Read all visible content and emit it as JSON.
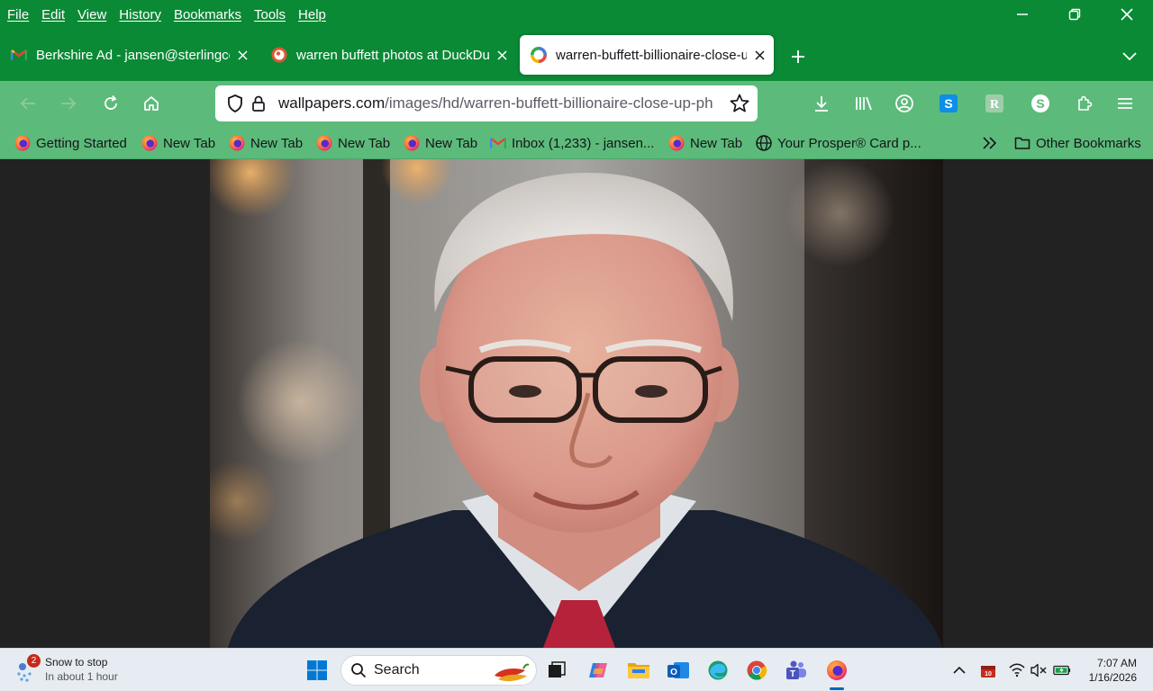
{
  "menu": {
    "items": [
      "File",
      "Edit",
      "View",
      "History",
      "Bookmarks",
      "Tools",
      "Help"
    ]
  },
  "tabs": [
    {
      "title": "Berkshire Ad - jansen@sterlingco",
      "icon": "gmail-icon"
    },
    {
      "title": "warren buffett photos at DuckDuckGo",
      "icon": "duckduckgo-icon"
    },
    {
      "title": "warren-buffett-billionaire-close-up",
      "icon": "wallpapers-icon"
    }
  ],
  "urlbar": {
    "domain": "wallpapers.com",
    "path": "/images/hd/warren-buffett-billionaire-close-up-photo"
  },
  "bookmarks": [
    {
      "label": "Getting Started",
      "icon": "firefox-icon"
    },
    {
      "label": "New Tab",
      "icon": "firefox-icon"
    },
    {
      "label": "New Tab",
      "icon": "firefox-icon"
    },
    {
      "label": "New Tab",
      "icon": "firefox-icon"
    },
    {
      "label": "New Tab",
      "icon": "firefox-icon"
    },
    {
      "label": "Inbox (1,233) - jansen...",
      "icon": "gmail-icon"
    },
    {
      "label": "New Tab",
      "icon": "firefox-icon"
    },
    {
      "label": "Your Prosper® Card p...",
      "icon": "globe-icon"
    }
  ],
  "other_bookmarks": "Other Bookmarks",
  "taskbar": {
    "weather_title": "Snow to stop",
    "weather_sub": "In about 1 hour",
    "weather_badge": "2",
    "search_label": "Search",
    "calendar_badge": "10",
    "time": "7:07 AM",
    "date": "1/16/2026"
  },
  "colors": {
    "titlebar": "#0b8a36",
    "toolbar": "#5cbb7a",
    "content_bg": "#222222"
  }
}
